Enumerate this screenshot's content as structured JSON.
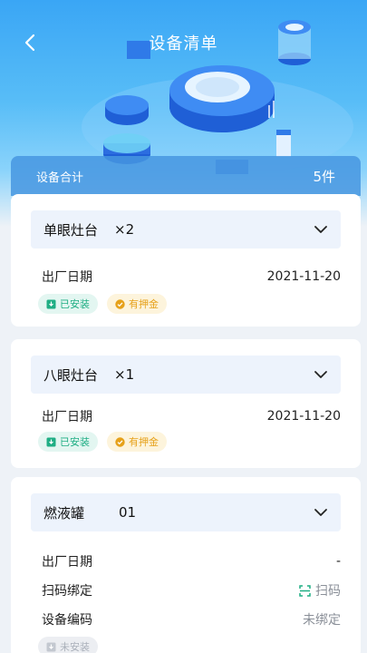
{
  "header": {
    "title": "设备清单",
    "back_icon": "chevron-left-icon"
  },
  "summary": {
    "label": "设备合计",
    "count": "5件"
  },
  "devices": [
    {
      "name": "单眼灶台",
      "qty": "×2",
      "rows": [
        {
          "label": "出厂日期",
          "value": "2021-11-20"
        }
      ],
      "tags": [
        {
          "label": "已安装",
          "icon": "install-box-icon",
          "color": "#1fae84"
        },
        {
          "label": "有押金",
          "icon": "check-circle-icon",
          "color": "#e6a11a"
        }
      ]
    },
    {
      "name": "八眼灶台",
      "qty": "×1",
      "rows": [
        {
          "label": "出厂日期",
          "value": "2021-11-20"
        }
      ],
      "tags": [
        {
          "label": "已安装",
          "icon": "install-box-icon",
          "color": "#1fae84"
        },
        {
          "label": "有押金",
          "icon": "check-circle-icon",
          "color": "#e6a11a"
        }
      ]
    },
    {
      "name": "燃液罐",
      "qty": "01",
      "rows": [
        {
          "label": "出厂日期",
          "value": "-"
        },
        {
          "label": "扫码绑定",
          "value": "扫码"
        },
        {
          "label": "设备编码",
          "value": "未绑定"
        }
      ],
      "tags": [
        {
          "label": "未安装",
          "icon": "install-box-icon",
          "color": "#aab0ba"
        }
      ]
    }
  ],
  "colors": {
    "header_blue": "#3aa6f5",
    "summary_blue": "#4696e1",
    "installed_green": "#1fae84",
    "deposit_yellow": "#e6a11a"
  }
}
